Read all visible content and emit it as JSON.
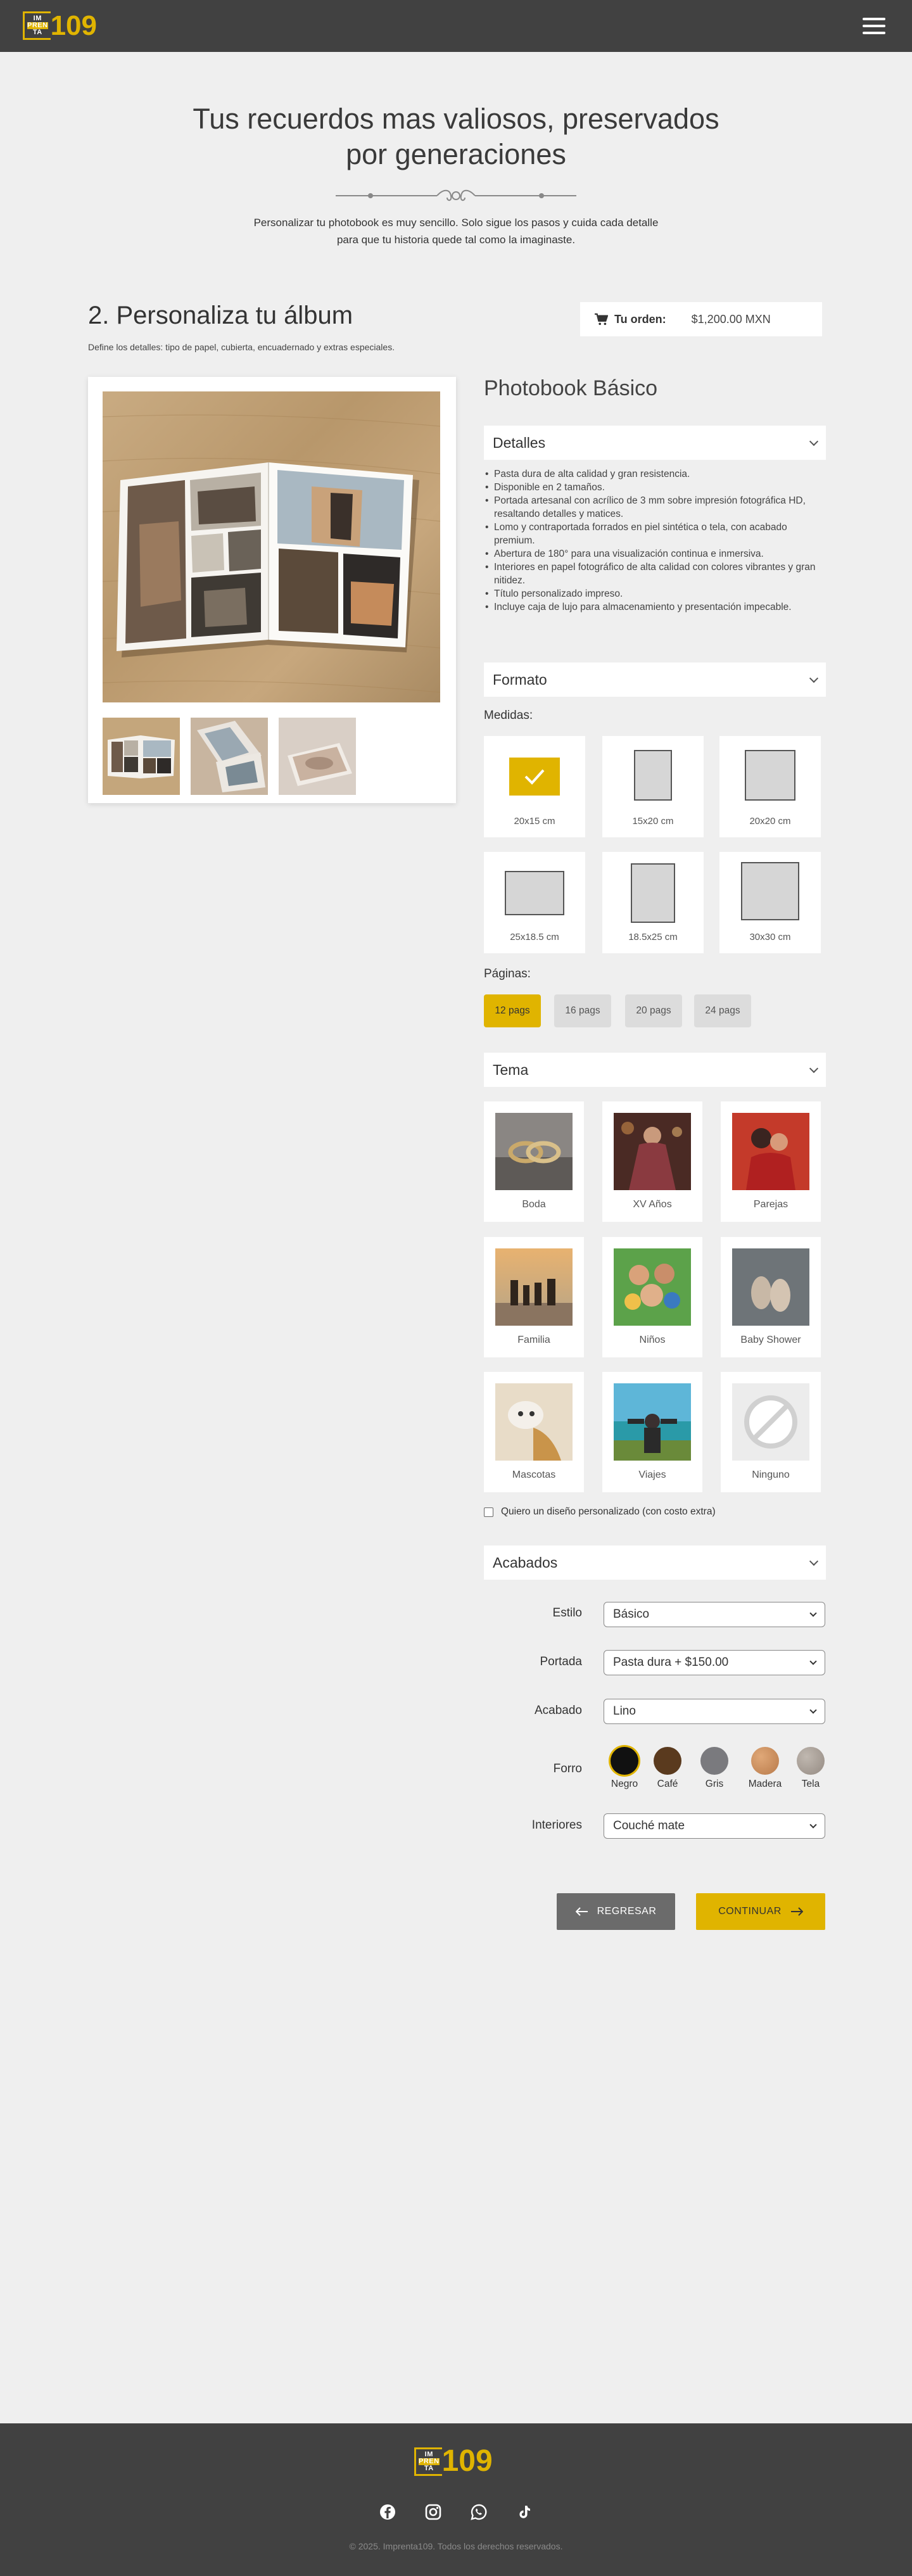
{
  "header": {
    "logo_text_1": "IM",
    "logo_text_2": "PREN",
    "logo_text_3": "TA",
    "logo_number": "109",
    "menu_icon": "hamburger-icon"
  },
  "hero": {
    "title_line1": "Tus recuerdos mas valiosos, preservados",
    "title_line2": "por generaciones",
    "text_line1": "Personalizar tu photobook es muy sencillo. Solo sigue los pasos y cuida cada detalle",
    "text_line2": "para que tu historia quede tal como la imaginaste."
  },
  "step": {
    "title": "2. Personaliza tu álbum",
    "subtitle": "Define los detalles: tipo de papel, cubierta, encuadernado y extras especiales."
  },
  "order": {
    "icon": "cart-icon",
    "label": "Tu orden:",
    "value": "$1,200.00 MXN"
  },
  "product": {
    "title": "Photobook Básico"
  },
  "details": {
    "heading": "Detalles",
    "items": [
      "Pasta dura de alta calidad y gran resistencia.",
      "Disponible en 2 tamaños.",
      "Portada artesanal con acrílico de 3 mm sobre impresión fotográfica HD, resaltando detalles y matices.",
      "Lomo y contraportada forrados en piel sintética o tela, con acabado premium.",
      "Abertura de 180° para una visualización continua e inmersiva.",
      "Interiores en papel fotográfico de alta calidad con colores vibrantes y gran nitidez.",
      "Título personalizado impreso.",
      "Incluye caja de lujo para almacenamiento y presentación impecable."
    ]
  },
  "format": {
    "heading": "Formato",
    "sizes_label": "Medidas:",
    "sizes": [
      "20x15 cm",
      "15x20 cm",
      "20x20 cm",
      "25x18.5 cm",
      "18.5x25 cm",
      "30x30 cm"
    ],
    "selected_size": "20x15 cm",
    "pages_label": "Páginas:",
    "pages": [
      "12 pags",
      "16 pags",
      "20 pags",
      "24 pags"
    ],
    "selected_pages": "12 pags"
  },
  "theme": {
    "heading": "Tema",
    "items": [
      "Boda",
      "XV Años",
      "Parejas",
      "Familia",
      "Niños",
      "Baby Shower",
      "Mascotas",
      "Viajes",
      "Ninguno"
    ],
    "custom_label": "Quiero un diseño personalizado (con costo extra)"
  },
  "finishes": {
    "heading": "Acabados",
    "estilo_label": "Estilo",
    "estilo_value": "Básico",
    "portada_label": "Portada",
    "portada_value": "Pasta dura + $150.00",
    "acabado_label": "Acabado",
    "acabado_value": "Lino",
    "forro_label": "Forro",
    "forro_options": [
      {
        "name": "Negro",
        "color": "#111111"
      },
      {
        "name": "Café",
        "color": "#5a3a1e"
      },
      {
        "name": "Gris",
        "color": "#7a7a7e"
      },
      {
        "name": "Madera",
        "color": "#c98a5a"
      },
      {
        "name": "Tela",
        "color": "#a89f97"
      }
    ],
    "selected_forro": "Negro",
    "interiores_label": "Interiores",
    "interiores_value": "Couché mate"
  },
  "actions": {
    "back": "REGRESAR",
    "next": "CONTINUAR"
  },
  "footer": {
    "social": [
      "facebook-icon",
      "instagram-icon",
      "whatsapp-icon",
      "tiktok-icon"
    ],
    "copyright": "© 2025. Imprenta109. Todos los derechos reservados."
  },
  "colors": {
    "accent": "#e0b400",
    "dark": "#414141",
    "background": "#efefef"
  }
}
